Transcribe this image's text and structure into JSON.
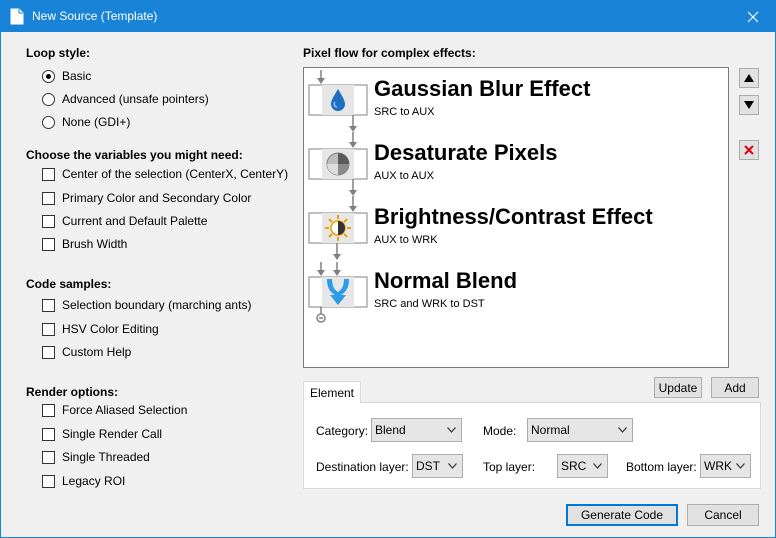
{
  "window": {
    "title": "New Source (Template)"
  },
  "loop_style": {
    "label": "Loop style:",
    "options": [
      {
        "label": "Basic",
        "checked": true
      },
      {
        "label": "Advanced (unsafe pointers)",
        "checked": false
      },
      {
        "label": "None (GDI+)",
        "checked": false
      }
    ]
  },
  "variables": {
    "label": "Choose the variables you might need:",
    "options": [
      {
        "label": "Center of the selection (CenterX, CenterY)",
        "checked": false
      },
      {
        "label": "Primary Color and Secondary Color",
        "checked": false
      },
      {
        "label": "Current and Default Palette",
        "checked": false
      },
      {
        "label": "Brush Width",
        "checked": false
      }
    ]
  },
  "code_samples": {
    "label": "Code samples:",
    "options": [
      {
        "label": "Selection boundary (marching ants)",
        "checked": false
      },
      {
        "label": "HSV Color Editing",
        "checked": false
      },
      {
        "label": "Custom Help",
        "checked": false
      }
    ]
  },
  "render_options": {
    "label": "Render options:",
    "options": [
      {
        "label": "Force Aliased Selection",
        "checked": false
      },
      {
        "label": "Single Render Call",
        "checked": false
      },
      {
        "label": "Single Threaded",
        "checked": false
      },
      {
        "label": "Legacy ROI",
        "checked": false
      }
    ]
  },
  "pixel_flow": {
    "label": "Pixel flow for complex effects:",
    "items": [
      {
        "title": "Gaussian Blur Effect",
        "subtitle": "SRC to AUX",
        "icon": "water-drop-icon"
      },
      {
        "title": "Desaturate Pixels",
        "subtitle": "AUX to AUX",
        "icon": "desaturate-icon"
      },
      {
        "title": "Brightness/Contrast Effect",
        "subtitle": "AUX to WRK",
        "icon": "brightness-icon"
      },
      {
        "title": "Normal Blend",
        "subtitle": "SRC and WRK to DST",
        "icon": "blend-icon"
      }
    ]
  },
  "side_buttons": {
    "up": "move-up-icon",
    "down": "move-down-icon",
    "delete": "delete-icon"
  },
  "actions": {
    "update": "Update",
    "add": "Add"
  },
  "element_tab": {
    "tab_label": "Element",
    "category_label": "Category:",
    "category_value": "Blend",
    "mode_label": "Mode:",
    "mode_value": "Normal",
    "destination_label": "Destination layer:",
    "destination_value": "DST",
    "top_label": "Top layer:",
    "top_value": "SRC",
    "bottom_label": "Bottom layer:",
    "bottom_value": "WRK"
  },
  "footer": {
    "generate": "Generate Code",
    "cancel": "Cancel"
  },
  "colors": {
    "title_bar": "#1883d7",
    "accent": "#0078d7",
    "delete_red": "#e0000f",
    "flow_arrow": "#808080"
  }
}
